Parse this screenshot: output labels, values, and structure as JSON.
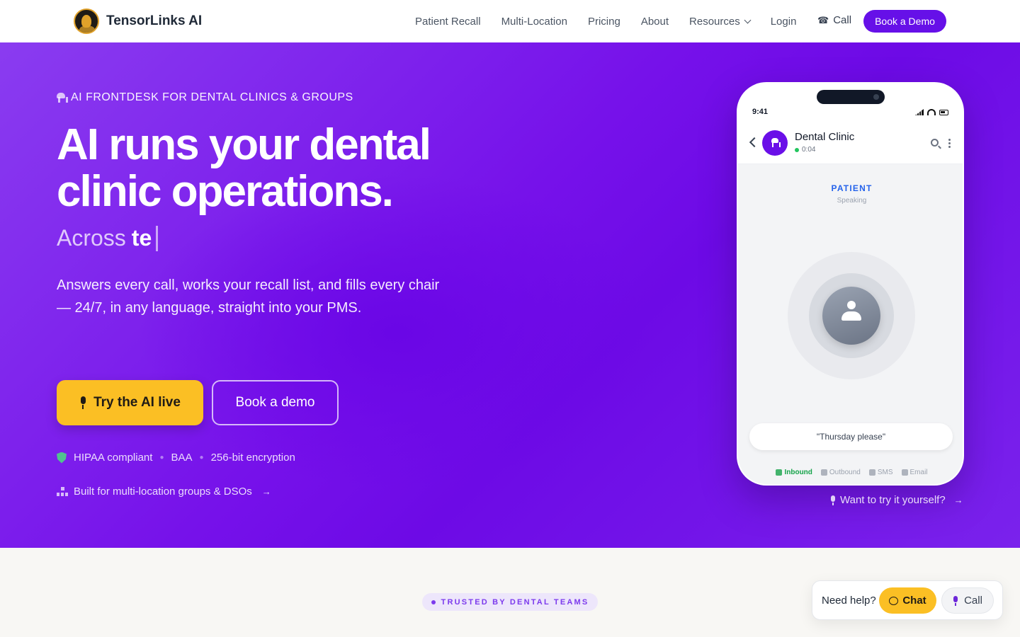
{
  "header": {
    "brand": "TensorLinks AI",
    "nav": [
      {
        "label": "Patient Recall"
      },
      {
        "label": "Multi-Location"
      },
      {
        "label": "Pricing"
      },
      {
        "label": "About"
      },
      {
        "label": "Resources",
        "has_dropdown": true
      },
      {
        "label": "Login"
      }
    ],
    "call_label": "Call",
    "demo_label": "Book a Demo"
  },
  "hero": {
    "eyebrow": "AI FRONTDESK FOR DENTAL CLINICS & GROUPS",
    "headline_line1": "AI runs your dental",
    "headline_line2": "clinic operations.",
    "typewriter_prefix": "Across",
    "typewriter_text": "te",
    "description": "Answers every call, works your recall list, and fills every chair — 24/7, in any language, straight into your PMS.",
    "try_button": "Try the AI live",
    "demo_button": "Book a demo",
    "badges": [
      "HIPAA compliant",
      "BAA",
      "256-bit encryption"
    ],
    "multi_location": "Built for multi-location groups & DSOs",
    "multi_location_arrow": "→",
    "try_yourself": "Want to try it yourself?",
    "try_yourself_arrow": "→"
  },
  "phone": {
    "time": "9:41",
    "clinic_name": "Dental Clinic",
    "call_timer": "0:04",
    "speaker": "PATIENT",
    "speaker_status": "Speaking",
    "transcript": "\"Thursday please\"",
    "tabs": [
      {
        "label": "Inbound",
        "active": true
      },
      {
        "label": "Outbound",
        "active": false
      },
      {
        "label": "SMS",
        "active": false
      },
      {
        "label": "Email",
        "active": false
      }
    ]
  },
  "trusted": {
    "label": "TRUSTED BY DENTAL TEAMS"
  },
  "help_widget": {
    "label": "Need help?",
    "chat": "Chat",
    "call": "Call"
  },
  "colors": {
    "brand_purple": "#6610e8",
    "accent_yellow": "#fbbf24",
    "active_green": "#16a34a"
  }
}
